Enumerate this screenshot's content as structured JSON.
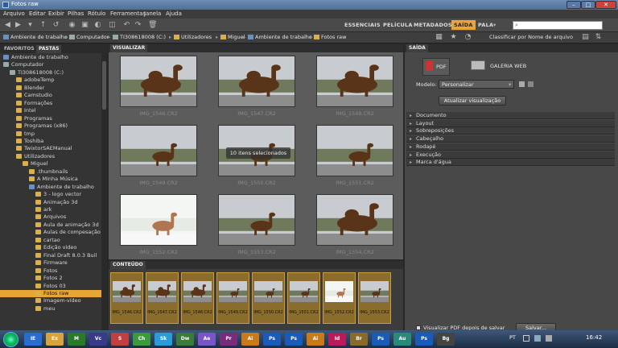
{
  "window": {
    "title": "Fotos raw"
  },
  "menu": [
    "Arquivo",
    "Editar",
    "Exibir",
    "Pilhas",
    "Rótulo",
    "Ferramentas",
    "Janela",
    "Ajuda"
  ],
  "workspaces": [
    "ESSENCIAIS",
    "PELÍCULA",
    "METADADOS",
    "SAÍDA",
    "PALA"
  ],
  "active_workspace": "SAÍDA",
  "breadcrumb": [
    "Ambiente de trabalho",
    "Computador",
    "TI308618008 (C:)",
    "Utilizadores",
    "Miguel",
    "Ambiente de trabalho",
    "Fotos raw"
  ],
  "sort_label": "Classificar por Nome de arquivo",
  "left_panel": {
    "tabs": [
      "FAVORITOS",
      "PASTAS"
    ],
    "active_tab": "PASTAS",
    "tree": [
      {
        "label": "Ambiente de trabalho",
        "indent": 0,
        "kind": "blue"
      },
      {
        "label": "Computador",
        "indent": 0,
        "kind": "drive"
      },
      {
        "label": "TI308618008 (C:)",
        "indent": 1,
        "kind": "drive"
      },
      {
        "label": "adobeTemp",
        "indent": 2,
        "kind": "folder"
      },
      {
        "label": "Blender",
        "indent": 2,
        "kind": "folder"
      },
      {
        "label": "Camstudio",
        "indent": 2,
        "kind": "folder"
      },
      {
        "label": "Formações",
        "indent": 2,
        "kind": "folder"
      },
      {
        "label": "Intel",
        "indent": 2,
        "kind": "folder"
      },
      {
        "label": "Programas",
        "indent": 2,
        "kind": "folder"
      },
      {
        "label": "Programas (x86)",
        "indent": 2,
        "kind": "folder"
      },
      {
        "label": "tmp",
        "indent": 2,
        "kind": "folder"
      },
      {
        "label": "Toshiba",
        "indent": 2,
        "kind": "folder"
      },
      {
        "label": "TwixtorSAEManual",
        "indent": 2,
        "kind": "folder"
      },
      {
        "label": "Utilizadores",
        "indent": 2,
        "kind": "folder"
      },
      {
        "label": "Miguel",
        "indent": 3,
        "kind": "folder"
      },
      {
        "label": ".thumbnails",
        "indent": 4,
        "kind": "folder"
      },
      {
        "label": "A Minha Música",
        "indent": 4,
        "kind": "folder"
      },
      {
        "label": "Ambiente de trabalho",
        "indent": 4,
        "kind": "blue"
      },
      {
        "label": "3 - logo vector",
        "indent": 5,
        "kind": "folder"
      },
      {
        "label": "Animação 3d",
        "indent": 5,
        "kind": "folder"
      },
      {
        "label": "ark",
        "indent": 5,
        "kind": "folder"
      },
      {
        "label": "Arquivos",
        "indent": 5,
        "kind": "folder"
      },
      {
        "label": "Aula de animação 3d",
        "indent": 5,
        "kind": "folder"
      },
      {
        "label": "Aulas de compesação",
        "indent": 5,
        "kind": "folder"
      },
      {
        "label": "cartao",
        "indent": 5,
        "kind": "folder"
      },
      {
        "label": "Edição video",
        "indent": 5,
        "kind": "folder"
      },
      {
        "label": "Final Draft 8.0.3 Buil",
        "indent": 5,
        "kind": "folder"
      },
      {
        "label": "Firmware",
        "indent": 5,
        "kind": "folder"
      },
      {
        "label": "Fotos",
        "indent": 5,
        "kind": "folder"
      },
      {
        "label": "Fotos 2",
        "indent": 5,
        "kind": "folder"
      },
      {
        "label": "Fotos 03",
        "indent": 5,
        "kind": "folder"
      },
      {
        "label": "Fotos raw",
        "indent": 5,
        "kind": "folder",
        "selected": true
      },
      {
        "label": "Imagem-vídeo",
        "indent": 5,
        "kind": "folder"
      },
      {
        "label": "meu",
        "indent": 5,
        "kind": "folder"
      }
    ]
  },
  "viewer": {
    "tab": "VISUALIZAR",
    "selection_badge": "10 itens selecionados",
    "thumbnails": [
      {
        "name": "IMG_1546.CR2",
        "scene": "camel_close",
        "bright": false
      },
      {
        "name": "IMG_1547.CR2",
        "scene": "camel_close",
        "bright": false
      },
      {
        "name": "IMG_1548.CR2",
        "scene": "camel_close",
        "bright": false
      },
      {
        "name": "IMG_1549.CR2",
        "scene": "camel_far",
        "bright": false
      },
      {
        "name": "IMG_1550.CR2",
        "scene": "camel_far",
        "bright": false
      },
      {
        "name": "IMG_1551.CR2",
        "scene": "camel_far",
        "bright": false
      },
      {
        "name": "IMG_1552.CR2",
        "scene": "camel_far",
        "bright": true
      },
      {
        "name": "IMG_1553.CR2",
        "scene": "camel_far",
        "bright": false
      },
      {
        "name": "IMG_1554.CR2",
        "scene": "camel_close",
        "bright": false
      }
    ]
  },
  "filmstrip": {
    "tab": "CONTEÚDO",
    "items": [
      "IMG_1546.CR2",
      "IMG_1547.CR2",
      "IMG_1548.CR2",
      "IMG_1549.CR2",
      "IMG_1550.CR2",
      "IMG_1551.CR2",
      "IMG_1552.CR2",
      "IMG_1553.CR2"
    ]
  },
  "output_panel": {
    "tab": "SAÍDA",
    "pdf_label": "PDF",
    "web_label": "GALERIA WEB",
    "template_label": "Modelo:",
    "template_value": "Personalizar",
    "refresh_button": "Atualizar visualização",
    "sections": [
      "Documento",
      "Layout",
      "Sobreposições",
      "Cabeçalho",
      "Rodapé",
      "Execução",
      "Marca d'água"
    ],
    "view_pdf_checkbox": "Visualizar PDF depois de salvar",
    "save_button": "Salvar..."
  },
  "taskbar": {
    "apps": [
      "IE",
      "Ex",
      "M",
      "Vc",
      "S",
      "Ch",
      "Sk",
      "Dw",
      "Ae",
      "Pr",
      "Ai",
      "Ps",
      "Ps",
      "Ai",
      "Id",
      "Br",
      "Ps",
      "Au",
      "Ps",
      "Bg"
    ],
    "language": "PT",
    "time": "16:42"
  },
  "colors": {
    "accent": "#e7a534",
    "panel": "#484848",
    "content": "#5c5c5c"
  }
}
